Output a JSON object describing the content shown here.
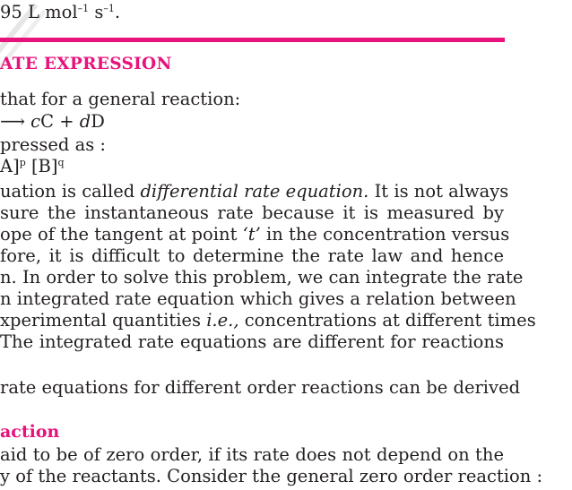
{
  "top_line": "95 L mol",
  "top_sup1": "–1",
  "top_mid": " s",
  "top_sup2": "–1",
  "top_end": ".",
  "section_title": "ATE EXPRESSION",
  "lines": {
    "l1": " that for a general reaction:",
    "l2_arrow": "⟶",
    "l2_c": " c",
    "l2_C": "C + ",
    "l2_d": "d",
    "l2_D": "D",
    "l3": "pressed as :",
    "l4_a": "A]",
    "l4_p": "p",
    "l4_b": " [B]",
    "l4_q": "q",
    "l5_a": "uation is called ",
    "l5_it": "differential rate equation.",
    "l5_b": " It is not always",
    "l6": "sure the instantaneous rate because it is measured by",
    "l7_a": "ope of the tangent at point ",
    "l7_it": "‘t’",
    "l7_b": " in the concentration versus",
    "l8": "fore, it is difficult to determine the rate law and hence",
    "l9": "n. In order to solve this problem, we can integrate the rate",
    "l10": "n integrated rate equation which gives a relation between",
    "l11_a": "xperimental quantities ",
    "l11_it": "i.e.,",
    "l11_b": " concentrations at different times",
    "l12": " The integrated rate equations are different for reactions",
    "l13": "rate equations for different order reactions can be derived",
    "l15": "aid to be of zero order, if its rate does not depend on the",
    "l16": "y of the reactants. Consider the general zero order reaction :"
  },
  "sub_title": "action"
}
